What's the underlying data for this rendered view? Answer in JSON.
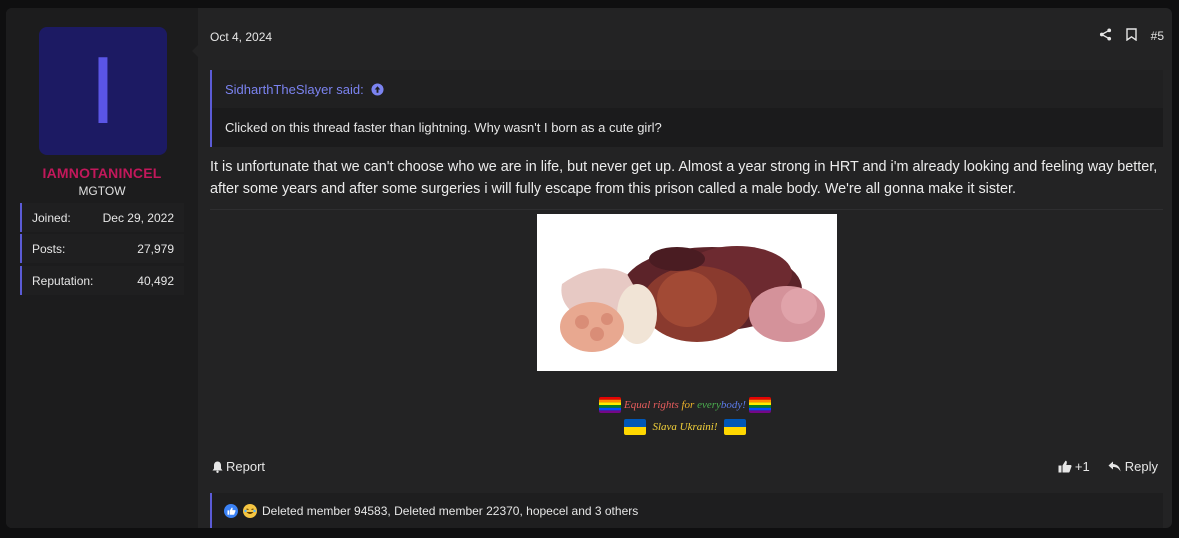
{
  "user": {
    "avatar_letter": "I",
    "avatar_bg": "#1c1a63",
    "avatar_fg": "#5a55e6",
    "name": "IAMNOTANINCEL",
    "name_color": "#c2185b",
    "title": "MGTOW",
    "stats": [
      {
        "label": "Joined:",
        "value": "Dec 29, 2022"
      },
      {
        "label": "Posts:",
        "value": "27,979"
      },
      {
        "label": "Reputation:",
        "value": "40,492"
      }
    ]
  },
  "post": {
    "date": "Oct 4, 2024",
    "number": "#5",
    "share_icon": "share-icon",
    "bookmark_icon": "bookmark-icon",
    "quote": {
      "author": "SidharthTheSlayer said:",
      "text": "Clicked on this thread faster than lightning. Why wasn't I born as a cute girl?"
    },
    "body": "It is unfortunate that we can't choose who we are in life, but never get up. Almost a year strong in HRT and i'm already looking and feeling way better, after some years and after some surgeries i will fully escape from this prison called a male body. We're all gonna make it sister.",
    "image_alt": "assorted raw organ meats"
  },
  "signature": {
    "line1_parts": [
      {
        "text": "Equal rights ",
        "color": "#e85d5d"
      },
      {
        "text": "for ",
        "color": "#f0b429"
      },
      {
        "text": "every",
        "color": "#4caf50"
      },
      {
        "text": "body!",
        "color": "#5b7be8"
      }
    ],
    "line2": "Slava Ukraini!",
    "line2_color": "#f3d23a"
  },
  "actions": {
    "report": "Report",
    "like_count": "+1",
    "reply": "Reply"
  },
  "reactions": {
    "text": "Deleted member 94583, Deleted member 22370, hopecel and 3 others"
  },
  "colors": {
    "accent": "#5b5bd6",
    "link": "#7b83f0"
  }
}
